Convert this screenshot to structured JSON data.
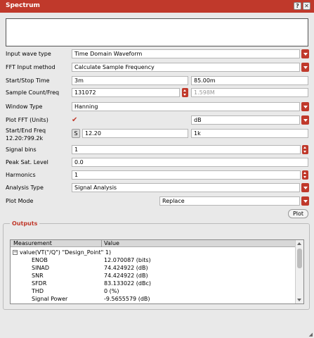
{
  "window": {
    "title": "Spectrum",
    "help_label": "?",
    "close_label": "✕",
    "colors": {
      "accent": "#c0392b"
    }
  },
  "form": {
    "input_wave_type": {
      "label": "Input wave type",
      "value": "Time Domain Waveform"
    },
    "fft_input_method": {
      "label": "FFT Input method",
      "value": "Calculate Sample Frequency"
    },
    "start_stop_time": {
      "label": "Start/Stop Time",
      "start": "3m",
      "stop": "85.00m"
    },
    "sample_count_freq": {
      "label": "Sample Count/Freq",
      "count": "131072",
      "freq": "1.598M"
    },
    "window_type": {
      "label": "Window Type",
      "value": "Hanning"
    },
    "plot_fft": {
      "label": "Plot FFT (Units)",
      "checked_glyph": "✔",
      "units": "dB"
    },
    "start_end_freq": {
      "label": "Start/End Freq",
      "sub_label": "12.20:799.2k",
      "s_button": "S",
      "start": "12.20",
      "end": "1k"
    },
    "signal_bins": {
      "label": "Signal bins",
      "value": "1"
    },
    "peak_sat_level": {
      "label": "Peak Sat. Level",
      "value": "0.0"
    },
    "harmonics": {
      "label": "Harmonics",
      "value": "1"
    },
    "analysis_type": {
      "label": "Analysis Type",
      "value": "Signal Analysis"
    },
    "plot_mode": {
      "label": "Plot Mode",
      "value": "Replace"
    },
    "plot_button": "Plot"
  },
  "outputs": {
    "title": "Outputs",
    "columns": {
      "measurement": "Measurement",
      "value": "Value"
    },
    "group": {
      "expander": "−",
      "label": "value(VT(\"/Q\") \"Design_Point\" 1)"
    },
    "rows": [
      {
        "m": "ENOB",
        "v": "12.070087 (bits)"
      },
      {
        "m": "SINAD",
        "v": "74.424922 (dB)"
      },
      {
        "m": "SNR",
        "v": "74.424922 (dB)"
      },
      {
        "m": "SFDR",
        "v": "83.133022 (dBc)"
      },
      {
        "m": "THD",
        "v": "0 (%)"
      },
      {
        "m": "Signal Power",
        "v": "-9.5655579 (dB)"
      }
    ]
  }
}
